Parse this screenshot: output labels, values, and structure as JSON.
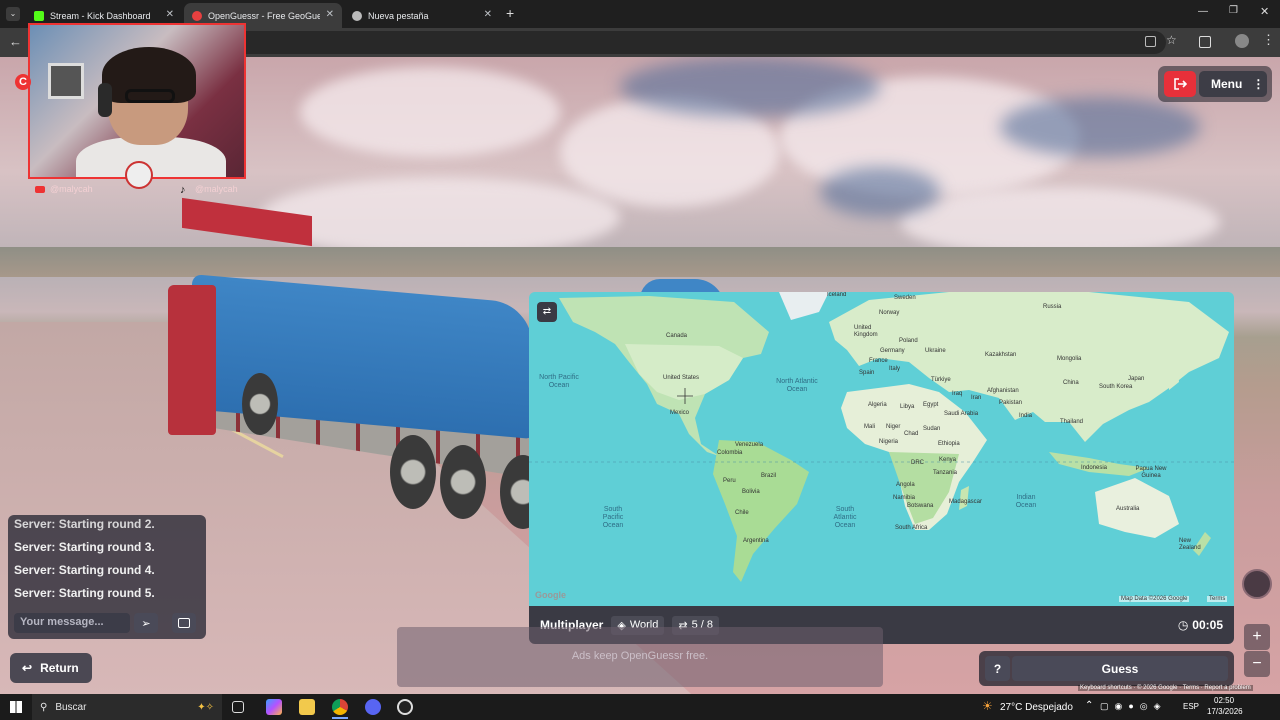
{
  "browser": {
    "tabs": [
      {
        "title": "Stream - Kick Dashboard",
        "active": false
      },
      {
        "title": "OpenGuessr - Free GeoGuessr",
        "active": true
      },
      {
        "title": "Nueva pestaña",
        "active": false
      }
    ],
    "new_tab_icon": "plus-icon",
    "window_controls": [
      "minimize-icon",
      "restore-icon",
      "close-icon"
    ]
  },
  "webcam": {
    "handle_youtube": "@malycah",
    "handle_tiktok": "@malycah"
  },
  "top_controls": {
    "exit_icon": "exit-icon",
    "menu_label": "Menu"
  },
  "map": {
    "countries": {
      "iceland": "Iceland",
      "sweden": "Sweden",
      "norway": "Norway",
      "russia": "Russia",
      "uk": "United Kingdom",
      "germany": "Germany",
      "poland": "Poland",
      "ukraine": "Ukraine",
      "france": "France",
      "spain": "Spain",
      "italy": "Italy",
      "kazakhstan": "Kazakhstan",
      "mongolia": "Mongolia",
      "turkiye": "Türkiye",
      "china": "China",
      "south_korea": "South Korea",
      "japan": "Japan",
      "iraq": "Iraq",
      "iran": "Iran",
      "afghanistan": "Afghanistan",
      "pakistan": "Pakistan",
      "algeria": "Algeria",
      "libya": "Libya",
      "egypt": "Egypt",
      "saudi": "Saudi Arabia",
      "india": "India",
      "thailand": "Thailand",
      "mali": "Mali",
      "niger": "Niger",
      "chad": "Chad",
      "sudan": "Sudan",
      "nigeria": "Nigeria",
      "ethiopia": "Ethiopia",
      "kenya": "Kenya",
      "drc": "DRC",
      "tanzania": "Tanzania",
      "angola": "Angola",
      "namibia": "Namibia",
      "botswana": "Botswana",
      "south_africa": "South Africa",
      "madagascar": "Madagascar",
      "indonesia": "Indonesia",
      "png": "Papua New Guinea",
      "australia": "Australia",
      "new_zealand": "New Zealand",
      "canada": "Canada",
      "usa": "United States",
      "mexico": "Mexico",
      "venezuela": "Venezuela",
      "colombia": "Colombia",
      "peru": "Peru",
      "brazil": "Brazil",
      "bolivia": "Bolivia",
      "chile": "Chile",
      "argentina": "Argentina"
    },
    "oceans": {
      "north_pacific": "North Pacific Ocean",
      "north_atlantic": "North Atlantic Ocean",
      "south_pacific": "South Pacific Ocean",
      "south_atlantic": "South Atlantic Ocean",
      "indian": "Indian Ocean"
    },
    "attribution": "Map Data ©2026 Google",
    "terms": "Terms",
    "google_logo": "Google"
  },
  "map_bar": {
    "mode": "Multiplayer",
    "region": "World",
    "round": "5 / 8",
    "timer": "00:05"
  },
  "chat": {
    "messages": [
      "Server: Starting round 2.",
      "Server: Starting round 3.",
      "Server: Starting round 4.",
      "Server: Starting round 5."
    ],
    "placeholder": "Your message..."
  },
  "bottom": {
    "return_label": "Return",
    "ads_text": "Ads keep OpenGuessr free.",
    "help_label": "?",
    "guess_label": "Guess",
    "zoom_in": "+",
    "zoom_out": "−"
  },
  "footer_links": {
    "shortcuts": "Keyboard shortcuts",
    "copyright": "© 2026 Google",
    "terms": "Terms",
    "report": "Report a problem"
  },
  "taskbar": {
    "search": "Buscar",
    "weather": "27°C  Despejado",
    "lang": "ESP",
    "time": "02:50",
    "date": "17/3/2026"
  }
}
